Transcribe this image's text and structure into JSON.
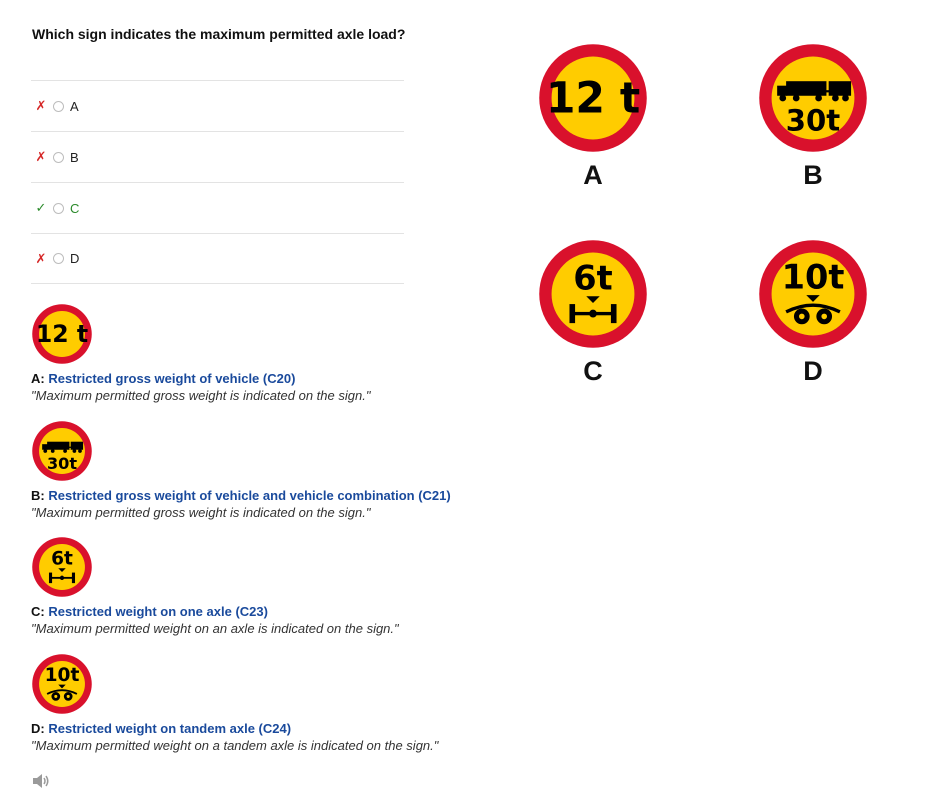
{
  "question": "Which sign indicates the maximum permitted axle load?",
  "answers": [
    {
      "label": "A",
      "status": "wrong",
      "mark": "✗"
    },
    {
      "label": "B",
      "status": "wrong",
      "mark": "✗"
    },
    {
      "label": "C",
      "status": "correct",
      "mark": "✓"
    },
    {
      "label": "D",
      "status": "wrong",
      "mark": "✗"
    }
  ],
  "signs": {
    "A": {
      "text": "12 t"
    },
    "B": {
      "text": "30t"
    },
    "C": {
      "text": "6t"
    },
    "D": {
      "text": "10t"
    }
  },
  "explanations": [
    {
      "letter": "A:",
      "title": "Restricted gross weight of vehicle (C20)",
      "desc": "\"Maximum permitted gross weight is indicated on the sign.\""
    },
    {
      "letter": "B:",
      "title": "Restricted gross weight of vehicle and vehicle combination (C21)",
      "desc": "\"Maximum permitted gross weight is indicated on the sign.\""
    },
    {
      "letter": "C:",
      "title": "Restricted weight on one axle (C23)",
      "desc": "\"Maximum permitted weight on an axle is indicated on the sign.\""
    },
    {
      "letter": "D:",
      "title": "Restricted weight on tandem axle (C24)",
      "desc": "\"Maximum permitted weight on a tandem axle is indicated on the sign.\""
    }
  ],
  "big_labels": [
    "A",
    "B",
    "C",
    "D"
  ],
  "colors": {
    "sign_red": "#d9112c",
    "sign_yellow": "#ffcc00",
    "link_blue": "#1a4a9c",
    "correct_green": "#2a8a2a",
    "wrong_red": "#d62828"
  },
  "icons": {
    "sound": "speaker-icon"
  }
}
